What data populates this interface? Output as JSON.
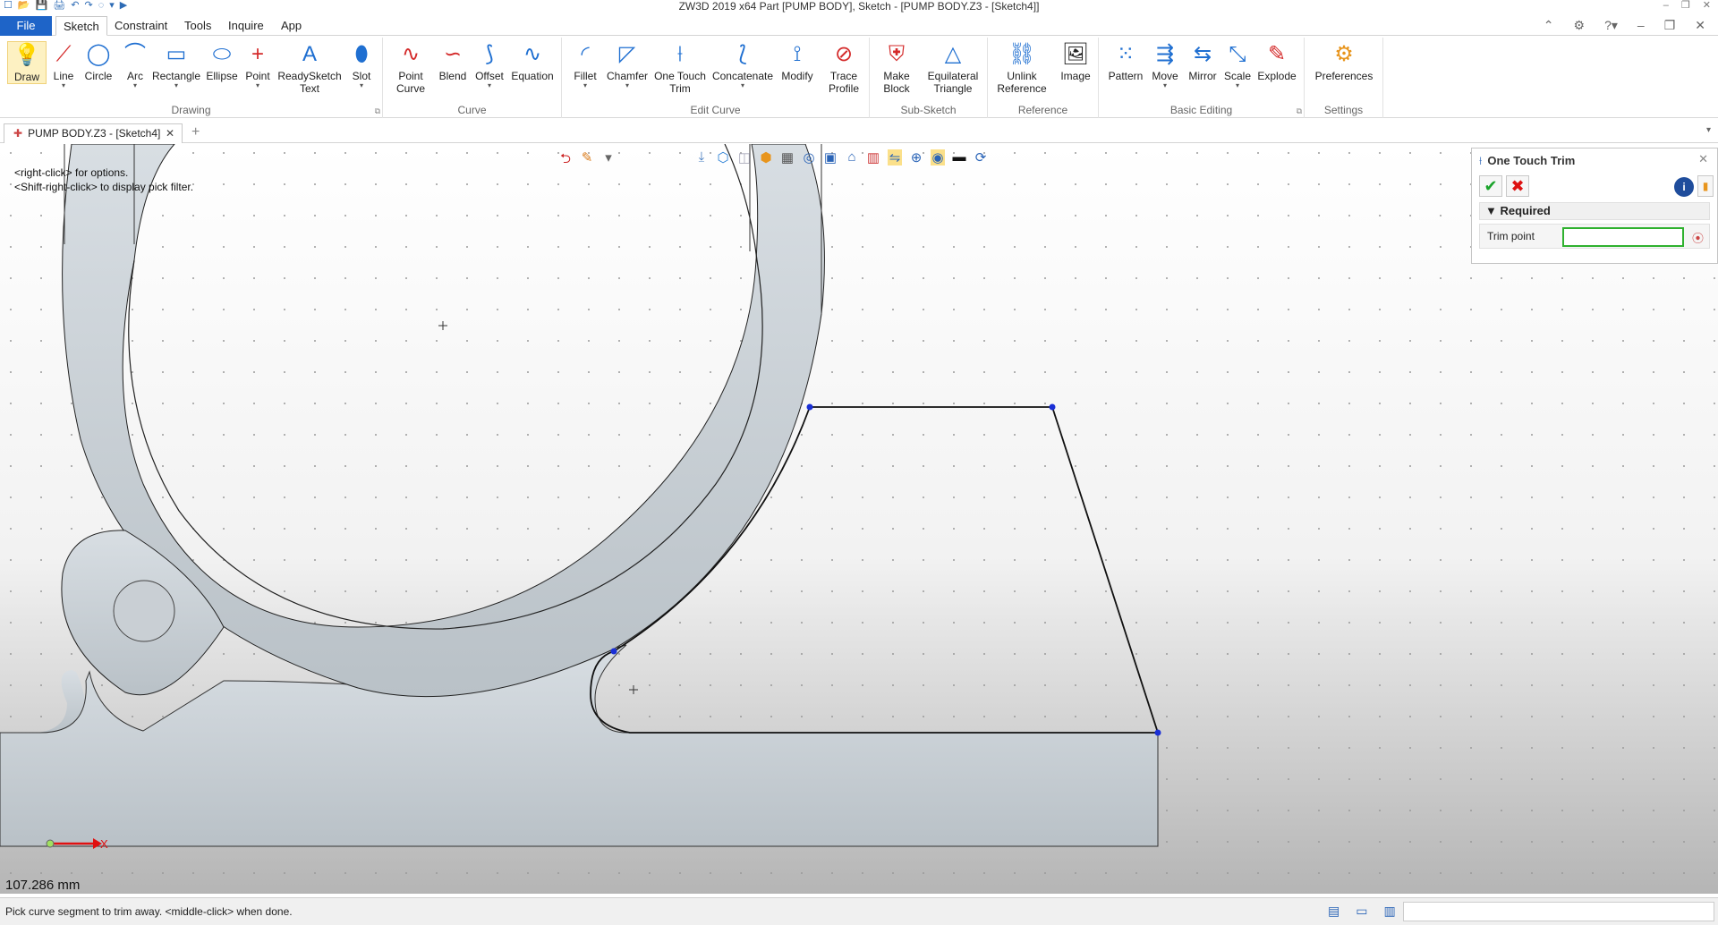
{
  "window": {
    "title": "ZW3D 2019  x64          Part [PUMP BODY],  Sketch - [PUMP BODY.Z3 - [Sketch4]]",
    "quick_access": [
      "☐",
      "📂",
      "💾",
      "🖨",
      "↶",
      "↷",
      "◌",
      "▾",
      "▶"
    ],
    "controls": [
      "–",
      "❐",
      "✕"
    ]
  },
  "menu": {
    "file": "File",
    "tabs": [
      "Sketch",
      "Constraint",
      "Tools",
      "Inquire",
      "App"
    ],
    "active_tab": "Sketch",
    "right_icons": [
      "⌃",
      "⚙",
      "?▾",
      "–",
      "❐",
      "✕"
    ]
  },
  "ribbon": {
    "groups": [
      {
        "label": "Drawing",
        "tools": [
          {
            "label": "Draw",
            "icon": "💡",
            "icon_name": "draw-icon",
            "active": true
          },
          {
            "label": "Line",
            "icon": "⟋",
            "icon_name": "line-icon",
            "dropdown": true
          },
          {
            "label": "Circle",
            "icon": "◯",
            "icon_name": "circle-icon"
          },
          {
            "label": "Arc",
            "icon": "⌒",
            "icon_name": "arc-icon",
            "dropdown": true
          },
          {
            "label": "Rectangle",
            "icon": "▭",
            "icon_name": "rectangle-icon",
            "dropdown": true
          },
          {
            "label": "Ellipse",
            "icon": "⬭",
            "icon_name": "ellipse-icon"
          },
          {
            "label": "Point",
            "icon": "+",
            "icon_name": "point-icon",
            "dropdown": true
          },
          {
            "label": "ReadySketch\nText",
            "icon": "A",
            "icon_name": "text-icon",
            "dropdown": true
          },
          {
            "label": "Slot",
            "icon": "⬮",
            "icon_name": "slot-icon",
            "dropdown": true
          }
        ]
      },
      {
        "label": "Curve",
        "tools": [
          {
            "label": "Point\nCurve",
            "icon": "∿",
            "icon_name": "point-curve-icon",
            "dropdown": true
          },
          {
            "label": "Blend",
            "icon": "∽",
            "icon_name": "blend-icon"
          },
          {
            "label": "Offset",
            "icon": "⟆",
            "icon_name": "offset-icon",
            "dropdown": true
          },
          {
            "label": "Equation",
            "icon": "∿",
            "icon_name": "equation-icon"
          }
        ]
      },
      {
        "label": "Edit Curve",
        "tools": [
          {
            "label": "Fillet",
            "icon": "◜",
            "icon_name": "fillet-icon",
            "dropdown": true
          },
          {
            "label": "Chamfer",
            "icon": "◸",
            "icon_name": "chamfer-icon",
            "dropdown": true
          },
          {
            "label": "One Touch\nTrim",
            "icon": "⟊",
            "icon_name": "trim-icon"
          },
          {
            "label": "Concatenate",
            "icon": "⟅",
            "icon_name": "concatenate-icon",
            "dropdown": true
          },
          {
            "label": "Modify",
            "icon": "⟟",
            "icon_name": "modify-icon"
          },
          {
            "label": "Trace\nProfile",
            "icon": "⊘",
            "icon_name": "trace-profile-icon",
            "dropdown": true
          }
        ]
      },
      {
        "label": "Sub-Sketch",
        "tools": [
          {
            "label": "Make\nBlock",
            "icon": "⛨",
            "icon_name": "make-block-icon",
            "dropdown": true
          },
          {
            "label": "Equilateral\nTriangle",
            "icon": "△",
            "icon_name": "triangle-icon",
            "dropdown": true
          }
        ]
      },
      {
        "label": "Reference",
        "tools": [
          {
            "label": "Unlink\nReference",
            "icon": "⛓",
            "icon_name": "unlink-reference-icon",
            "dropdown": true
          },
          {
            "label": "Image",
            "icon": "🖼",
            "icon_name": "image-icon"
          }
        ]
      },
      {
        "label": "Basic Editing",
        "tools": [
          {
            "label": "Pattern",
            "icon": "⁙",
            "icon_name": "pattern-icon"
          },
          {
            "label": "Move",
            "icon": "⇶",
            "icon_name": "move-icon",
            "dropdown": true
          },
          {
            "label": "Mirror",
            "icon": "⇆",
            "icon_name": "mirror-icon"
          },
          {
            "label": "Scale",
            "icon": "⤡",
            "icon_name": "scale-icon",
            "dropdown": true
          },
          {
            "label": "Explode",
            "icon": "✎",
            "icon_name": "explode-icon"
          }
        ]
      },
      {
        "label": "Settings",
        "tools": [
          {
            "label": "Preferences",
            "icon": "⚙",
            "icon_name": "preferences-icon"
          }
        ]
      }
    ]
  },
  "document_tab": {
    "label": "PUMP BODY.Z3 - [Sketch4]",
    "close": "✕",
    "add": "+"
  },
  "canvas": {
    "hint_lines": [
      "<right-click> for options.",
      "<Shift-right-click> to display pick filter."
    ],
    "measurement": "107.286 mm",
    "axis_label": "X",
    "view_toolbar": [
      "⮌",
      "✎",
      "▾",
      "⤓",
      "⬡",
      "◫",
      "⬢",
      "▦",
      "◎",
      "▣",
      "⌂",
      "▥",
      "⇋",
      "⊕",
      "◉",
      "▬",
      "⟳"
    ]
  },
  "panel": {
    "title": "One Touch Trim",
    "title_icon": "trim-icon",
    "close": "✕",
    "ok_glyph": "✔",
    "cancel_glyph": "✖",
    "info_glyph": "i",
    "section": "Required",
    "section_toggle": "▼",
    "field_label": "Trim point",
    "field_value": ""
  },
  "status": {
    "text": "Pick curve segment to trim away.  <middle-click> when done.",
    "icons": [
      "▤",
      "▭",
      "▥"
    ]
  }
}
